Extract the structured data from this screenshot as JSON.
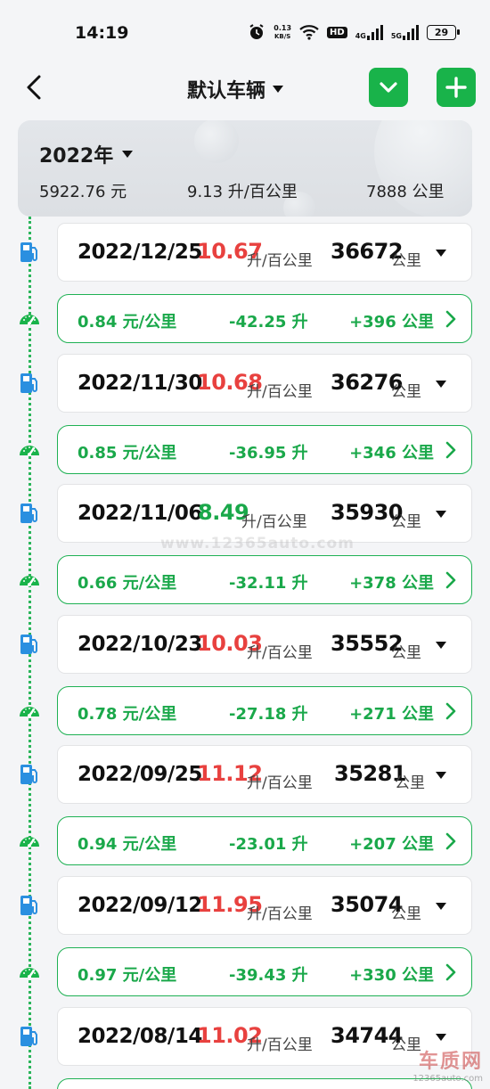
{
  "status_bar": {
    "time": "14:19",
    "speed_value": "0.13",
    "speed_unit": "KB/S",
    "hd_label": "HD",
    "sig1_label": "4G",
    "sig2_label": "5G",
    "battery": "29"
  },
  "nav": {
    "title": "默认车辆",
    "icons": [
      "back-icon",
      "chevron-down-icon",
      "plus-icon"
    ]
  },
  "summary": {
    "year": "2022年",
    "total_cost": "5922.76 元",
    "avg_consumption": "9.13 升/百公里",
    "total_distance": "7888 公里"
  },
  "records": [
    {
      "date": "2022/12/25",
      "consumption": "10.67",
      "consumption_status": "red",
      "consumption_unit": "升/百公里",
      "odometer": "36672",
      "odometer_unit": "公里"
    },
    {
      "date": "2022/11/30",
      "consumption": "10.68",
      "consumption_status": "red",
      "consumption_unit": "升/百公里",
      "odometer": "36276",
      "odometer_unit": "公里"
    },
    {
      "date": "2022/11/06",
      "consumption": "8.49",
      "consumption_status": "green",
      "consumption_unit": "升/百公里",
      "odometer": "35930",
      "odometer_unit": "公里"
    },
    {
      "date": "2022/10/23",
      "consumption": "10.03",
      "consumption_status": "red",
      "consumption_unit": "升/百公里",
      "odometer": "35552",
      "odometer_unit": "公里"
    },
    {
      "date": "2022/09/25",
      "consumption": "11.12",
      "consumption_status": "red",
      "consumption_unit": "升/百公里",
      "odometer": "35281",
      "odometer_unit": "公里"
    },
    {
      "date": "2022/09/12",
      "consumption": "11.95",
      "consumption_status": "red",
      "consumption_unit": "升/百公里",
      "odometer": "35074",
      "odometer_unit": "公里"
    },
    {
      "date": "2022/08/14",
      "consumption": "11.02",
      "consumption_status": "red",
      "consumption_unit": "升/百公里",
      "odometer": "34744",
      "odometer_unit": "公里"
    }
  ],
  "intervals": [
    {
      "cost_per_km": "0.84 元/公里",
      "liters": "-42.25 升",
      "distance": "+396 公里"
    },
    {
      "cost_per_km": "0.85 元/公里",
      "liters": "-36.95 升",
      "distance": "+346 公里"
    },
    {
      "cost_per_km": "0.66 元/公里",
      "liters": "-32.11 升",
      "distance": "+378 公里"
    },
    {
      "cost_per_km": "0.78 元/公里",
      "liters": "-27.18 升",
      "distance": "+271 公里"
    },
    {
      "cost_per_km": "0.94 元/公里",
      "liters": "-23.01 升",
      "distance": "+207 公里"
    },
    {
      "cost_per_km": "0.97 元/公里",
      "liters": "-39.43 升",
      "distance": "+330 公里"
    }
  ],
  "colors": {
    "accent_green": "#19b34a",
    "high_consumption_red": "#e8413f",
    "icon_blue": "#2a8fe0"
  },
  "watermark": {
    "url_text": "www.12365auto.com",
    "logo_text": "车质网",
    "logo_url": "12365auto.com"
  }
}
